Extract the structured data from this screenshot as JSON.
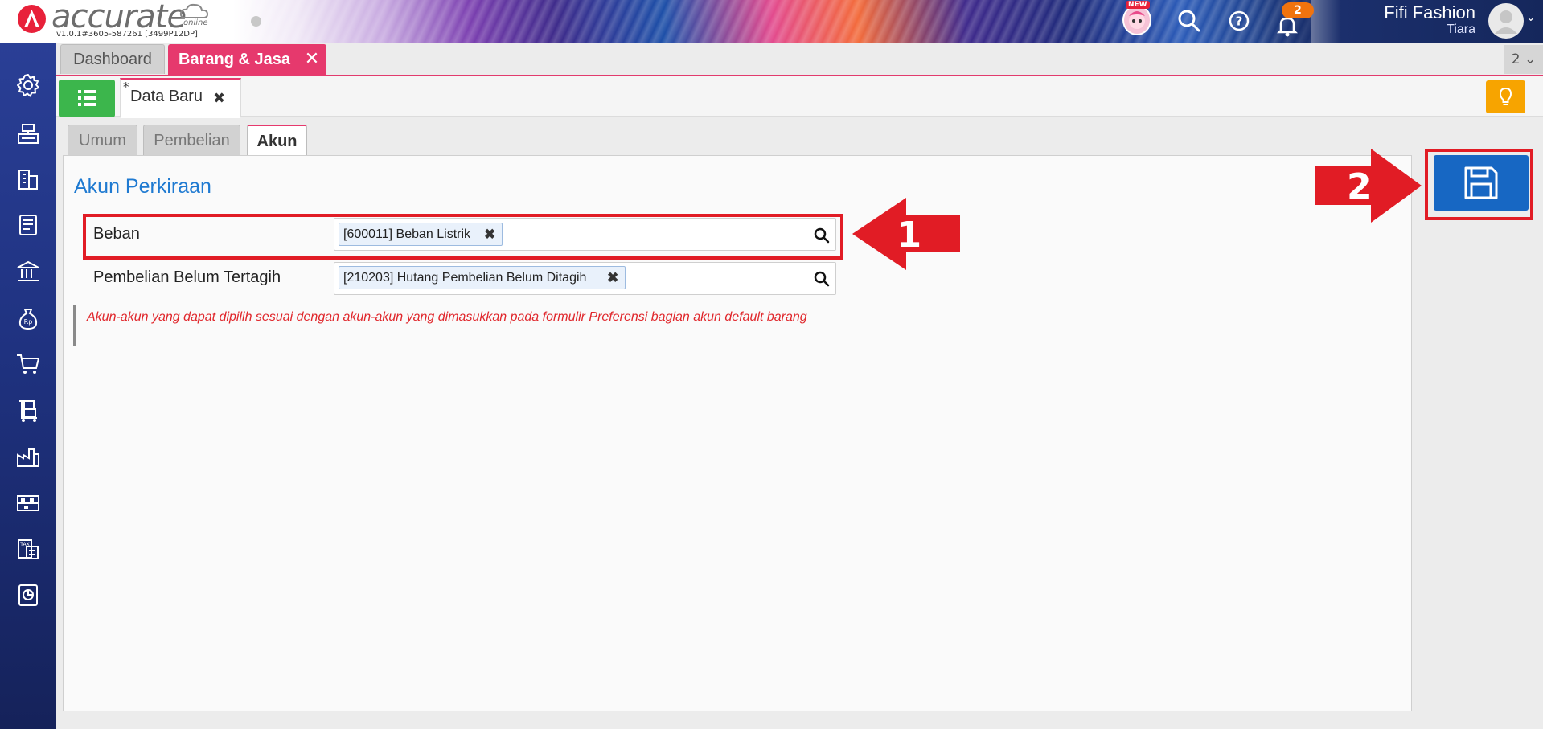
{
  "app": {
    "logo_text": "accurate",
    "logo_sub": "online",
    "version": "v1.0.1#3605-587261 [3499P12DP]"
  },
  "header": {
    "mascot_badge": "NEW",
    "notification_count": "2",
    "user_name": "Fifi Fashion",
    "user_sub": "Tiara"
  },
  "tabs": {
    "dashboard": "Dashboard",
    "active": "Barang & Jasa",
    "count": "2 ⌄"
  },
  "subtab": {
    "star": "*",
    "label": "Data Baru"
  },
  "form_tabs": [
    "Umum",
    "Pembelian",
    "Akun"
  ],
  "section": {
    "title": "Akun Perkiraan"
  },
  "rows": [
    {
      "label": "Beban",
      "chip": "[600011] Beban Listrik"
    },
    {
      "label": "Pembelian Belum Tertagih",
      "chip": "[210203] Hutang Pembelian Belum Ditagih"
    }
  ],
  "note": "Akun-akun yang dapat dipilih sesuai dengan akun-akun yang dimasukkan pada formulir Preferensi bagian akun default barang",
  "annotations": {
    "arrow1": "1",
    "arrow2": "2"
  },
  "colors": {
    "accent_pink": "#e6396d",
    "link_blue": "#1f7ad1",
    "save_blue": "#1767c3",
    "annotation_red": "#e11c25",
    "green": "#3cb64c",
    "orange": "#f7a400"
  }
}
